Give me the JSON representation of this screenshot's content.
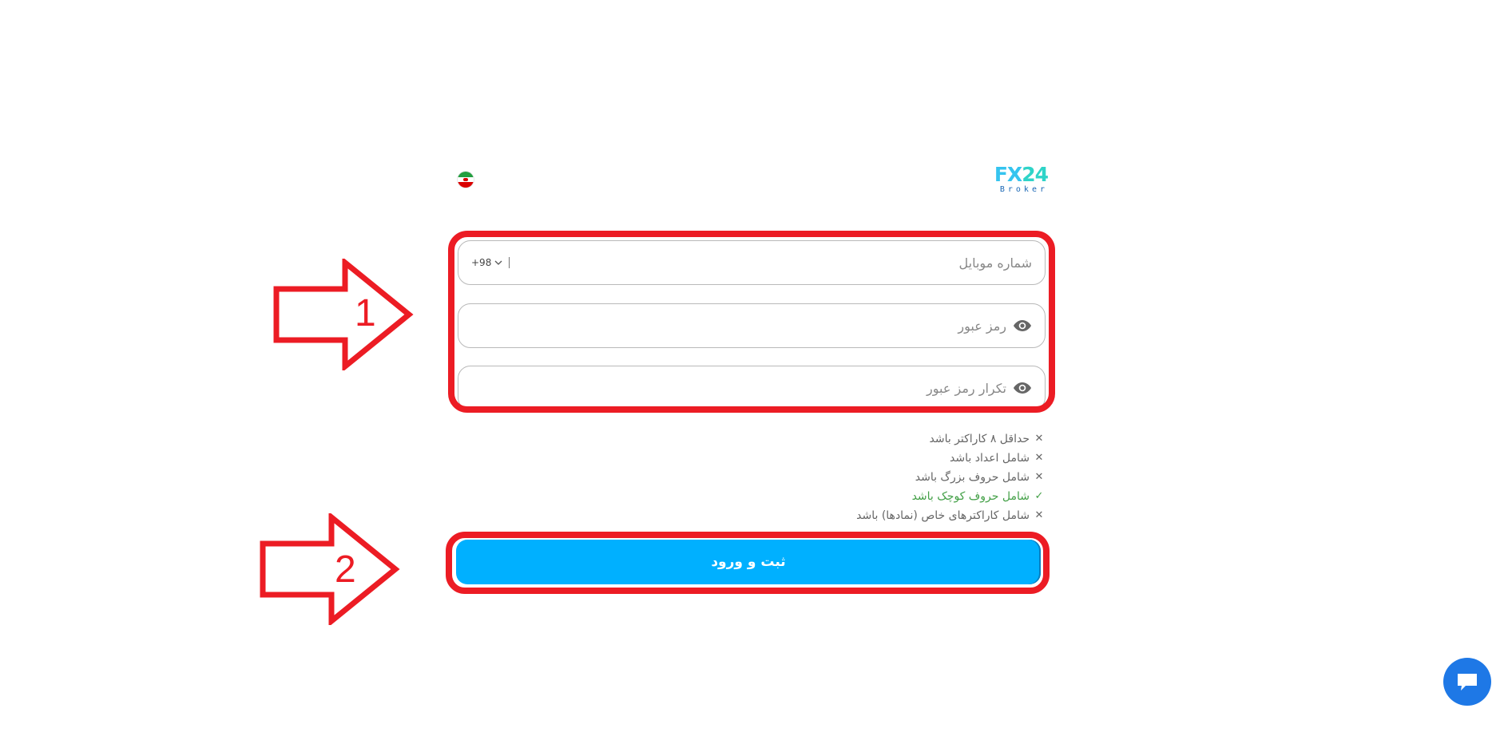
{
  "header": {
    "logo_main": "FX24",
    "logo_sub": "Broker",
    "language_flag": "iran-flag-icon"
  },
  "form": {
    "phone": {
      "placeholder": "شماره موبایل",
      "country_code": "+98"
    },
    "password": {
      "placeholder": "رمز عبور"
    },
    "password_confirm": {
      "placeholder": "تکرار رمز عبور"
    },
    "rules": [
      {
        "text": "حداقل ۸ کاراکتر باشد",
        "ok": false
      },
      {
        "text": "شامل اعداد باشد",
        "ok": false
      },
      {
        "text": "شامل حروف بزرگ باشد",
        "ok": false
      },
      {
        "text": "شامل حروف کوچک باشد",
        "ok": true
      },
      {
        "text": "شامل کاراکترهای خاص (نمادها) باشد",
        "ok": false
      }
    ],
    "submit_label": "ثبت و ورود"
  },
  "annotations": {
    "label_1": "1",
    "label_2": "2",
    "color": "#ec1c24"
  },
  "colors": {
    "primary": "#00b0ff",
    "success": "#43a047",
    "chat": "#1e78e6"
  }
}
